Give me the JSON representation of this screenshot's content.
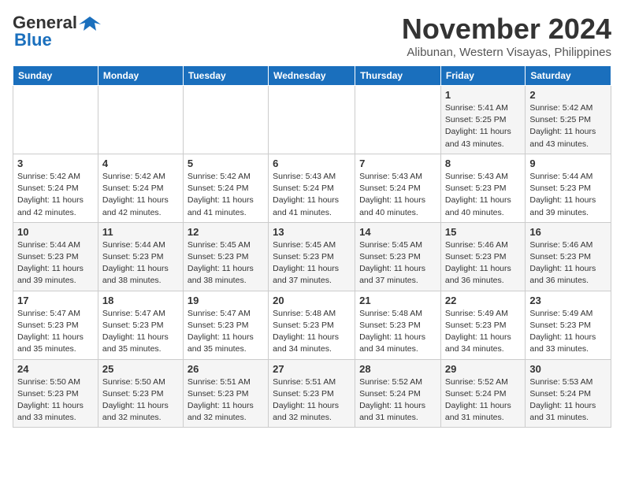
{
  "header": {
    "logo_line1": "General",
    "logo_line2": "Blue",
    "month_title": "November 2024",
    "location": "Alibunan, Western Visayas, Philippines"
  },
  "weekdays": [
    "Sunday",
    "Monday",
    "Tuesday",
    "Wednesday",
    "Thursday",
    "Friday",
    "Saturday"
  ],
  "weeks": [
    [
      {
        "day": "",
        "info": ""
      },
      {
        "day": "",
        "info": ""
      },
      {
        "day": "",
        "info": ""
      },
      {
        "day": "",
        "info": ""
      },
      {
        "day": "",
        "info": ""
      },
      {
        "day": "1",
        "info": "Sunrise: 5:41 AM\nSunset: 5:25 PM\nDaylight: 11 hours\nand 43 minutes."
      },
      {
        "day": "2",
        "info": "Sunrise: 5:42 AM\nSunset: 5:25 PM\nDaylight: 11 hours\nand 43 minutes."
      }
    ],
    [
      {
        "day": "3",
        "info": "Sunrise: 5:42 AM\nSunset: 5:24 PM\nDaylight: 11 hours\nand 42 minutes."
      },
      {
        "day": "4",
        "info": "Sunrise: 5:42 AM\nSunset: 5:24 PM\nDaylight: 11 hours\nand 42 minutes."
      },
      {
        "day": "5",
        "info": "Sunrise: 5:42 AM\nSunset: 5:24 PM\nDaylight: 11 hours\nand 41 minutes."
      },
      {
        "day": "6",
        "info": "Sunrise: 5:43 AM\nSunset: 5:24 PM\nDaylight: 11 hours\nand 41 minutes."
      },
      {
        "day": "7",
        "info": "Sunrise: 5:43 AM\nSunset: 5:24 PM\nDaylight: 11 hours\nand 40 minutes."
      },
      {
        "day": "8",
        "info": "Sunrise: 5:43 AM\nSunset: 5:23 PM\nDaylight: 11 hours\nand 40 minutes."
      },
      {
        "day": "9",
        "info": "Sunrise: 5:44 AM\nSunset: 5:23 PM\nDaylight: 11 hours\nand 39 minutes."
      }
    ],
    [
      {
        "day": "10",
        "info": "Sunrise: 5:44 AM\nSunset: 5:23 PM\nDaylight: 11 hours\nand 39 minutes."
      },
      {
        "day": "11",
        "info": "Sunrise: 5:44 AM\nSunset: 5:23 PM\nDaylight: 11 hours\nand 38 minutes."
      },
      {
        "day": "12",
        "info": "Sunrise: 5:45 AM\nSunset: 5:23 PM\nDaylight: 11 hours\nand 38 minutes."
      },
      {
        "day": "13",
        "info": "Sunrise: 5:45 AM\nSunset: 5:23 PM\nDaylight: 11 hours\nand 37 minutes."
      },
      {
        "day": "14",
        "info": "Sunrise: 5:45 AM\nSunset: 5:23 PM\nDaylight: 11 hours\nand 37 minutes."
      },
      {
        "day": "15",
        "info": "Sunrise: 5:46 AM\nSunset: 5:23 PM\nDaylight: 11 hours\nand 36 minutes."
      },
      {
        "day": "16",
        "info": "Sunrise: 5:46 AM\nSunset: 5:23 PM\nDaylight: 11 hours\nand 36 minutes."
      }
    ],
    [
      {
        "day": "17",
        "info": "Sunrise: 5:47 AM\nSunset: 5:23 PM\nDaylight: 11 hours\nand 35 minutes."
      },
      {
        "day": "18",
        "info": "Sunrise: 5:47 AM\nSunset: 5:23 PM\nDaylight: 11 hours\nand 35 minutes."
      },
      {
        "day": "19",
        "info": "Sunrise: 5:47 AM\nSunset: 5:23 PM\nDaylight: 11 hours\nand 35 minutes."
      },
      {
        "day": "20",
        "info": "Sunrise: 5:48 AM\nSunset: 5:23 PM\nDaylight: 11 hours\nand 34 minutes."
      },
      {
        "day": "21",
        "info": "Sunrise: 5:48 AM\nSunset: 5:23 PM\nDaylight: 11 hours\nand 34 minutes."
      },
      {
        "day": "22",
        "info": "Sunrise: 5:49 AM\nSunset: 5:23 PM\nDaylight: 11 hours\nand 34 minutes."
      },
      {
        "day": "23",
        "info": "Sunrise: 5:49 AM\nSunset: 5:23 PM\nDaylight: 11 hours\nand 33 minutes."
      }
    ],
    [
      {
        "day": "24",
        "info": "Sunrise: 5:50 AM\nSunset: 5:23 PM\nDaylight: 11 hours\nand 33 minutes."
      },
      {
        "day": "25",
        "info": "Sunrise: 5:50 AM\nSunset: 5:23 PM\nDaylight: 11 hours\nand 32 minutes."
      },
      {
        "day": "26",
        "info": "Sunrise: 5:51 AM\nSunset: 5:23 PM\nDaylight: 11 hours\nand 32 minutes."
      },
      {
        "day": "27",
        "info": "Sunrise: 5:51 AM\nSunset: 5:23 PM\nDaylight: 11 hours\nand 32 minutes."
      },
      {
        "day": "28",
        "info": "Sunrise: 5:52 AM\nSunset: 5:24 PM\nDaylight: 11 hours\nand 31 minutes."
      },
      {
        "day": "29",
        "info": "Sunrise: 5:52 AM\nSunset: 5:24 PM\nDaylight: 11 hours\nand 31 minutes."
      },
      {
        "day": "30",
        "info": "Sunrise: 5:53 AM\nSunset: 5:24 PM\nDaylight: 11 hours\nand 31 minutes."
      }
    ]
  ]
}
